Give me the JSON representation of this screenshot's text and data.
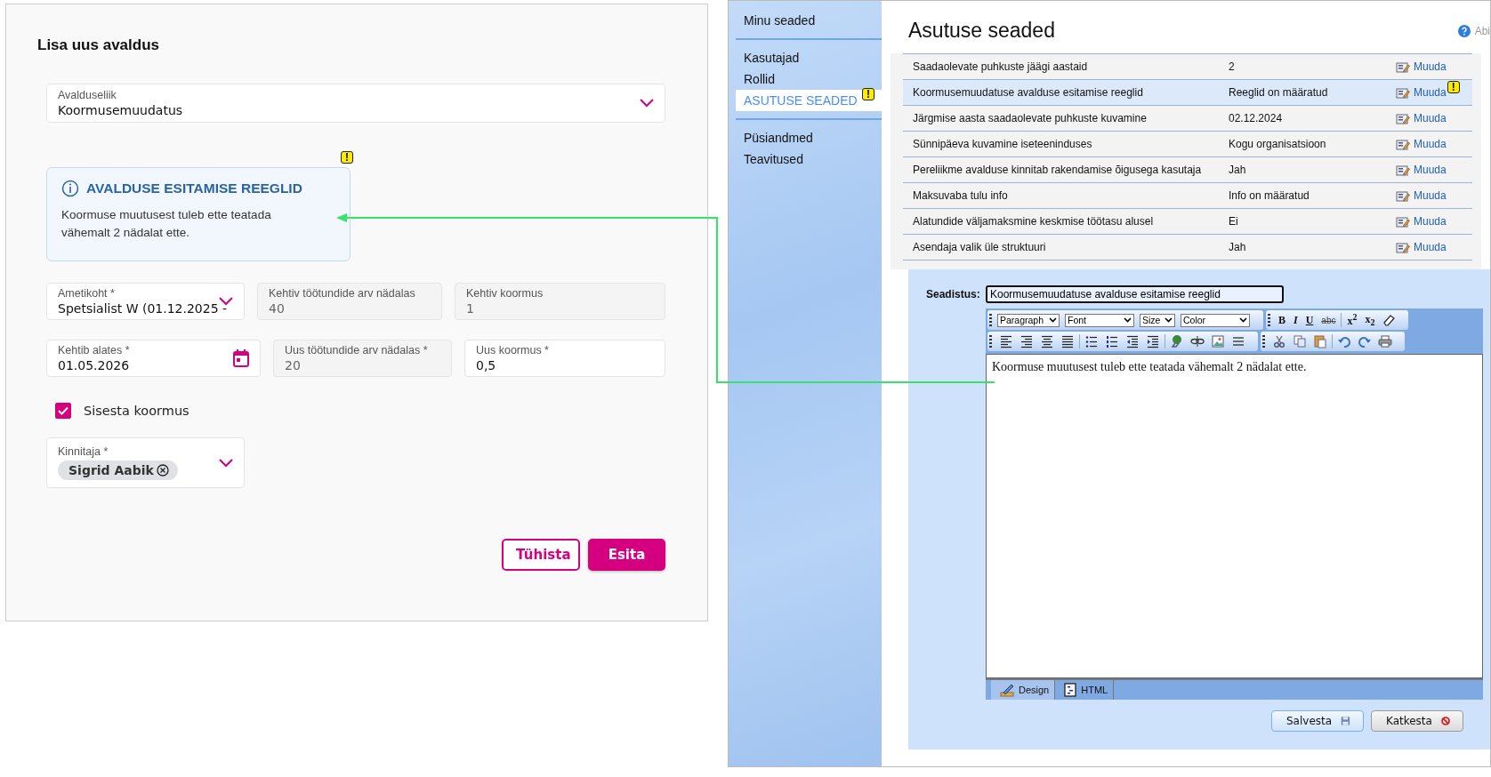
{
  "form": {
    "title": "Lisa uus avaldus",
    "type_field": {
      "label": "Avalduseliik",
      "value": "Koormusemuudatus"
    },
    "info": {
      "title": "AVALDUSE ESITAMISE REEGLID",
      "text": "Koormuse muutusest tuleb ette teatada vähemalt 2 nädalat ette.",
      "flag": "!"
    },
    "field_rows": [
      [
        {
          "kind": "select",
          "label": "Ametikoht *",
          "value": "Spetsialist W (01.12.2025 -",
          "disabled": false
        },
        {
          "kind": "text",
          "label": "Kehtiv töötundide arv nädalas",
          "value": "40",
          "disabled": true
        },
        {
          "kind": "text",
          "label": "Kehtiv koormus",
          "value": "1",
          "disabled": true
        }
      ],
      [
        {
          "kind": "date",
          "label": "Kehtib alates *",
          "value": "01.05.2026",
          "disabled": false
        },
        {
          "kind": "text",
          "label": "Uus töötundide arv nädalas *",
          "value": "20",
          "disabled": true
        },
        {
          "kind": "text",
          "label": "Uus koormus *",
          "value": "0,5",
          "disabled": false
        }
      ]
    ],
    "checkbox": {
      "label": "Sisesta koormus",
      "checked": true
    },
    "approver": {
      "label": "Kinnitaja *",
      "chip": "Sigrid Aabik"
    },
    "buttons": [
      {
        "label": "Tühista",
        "kind": "secondary"
      },
      {
        "label": "Esita",
        "kind": "primary"
      }
    ]
  },
  "settings": {
    "sidebar": [
      {
        "items": [
          {
            "label": "Minu seaded",
            "selected": false
          }
        ]
      },
      {
        "items": [
          {
            "label": "Kasutajad",
            "selected": false
          },
          {
            "label": "Rollid",
            "selected": false
          },
          {
            "label": "ASUTUSE SEADED",
            "selected": true,
            "flag": "!"
          }
        ]
      },
      {
        "items": [
          {
            "label": "Püsiandmed",
            "selected": false
          },
          {
            "label": "Teavitused",
            "selected": false
          }
        ]
      }
    ],
    "title": "Asutuse seaded",
    "help": "Abi",
    "rows": [
      {
        "name": "Saadaolevate puhkuste jäägi aastaid",
        "value": "2",
        "action": "Muuda",
        "selected": false
      },
      {
        "name": "Koormusemuudatuse avalduse esitamise reeglid",
        "value": "Reeglid on määratud",
        "action": "Muuda",
        "selected": true,
        "flag": "!"
      },
      {
        "name": "Järgmise aasta saadaolevate puhkuste kuvamine",
        "value": "02.12.2024",
        "action": "Muuda",
        "selected": false
      },
      {
        "name": "Sünnipäeva kuvamine iseteeninduses",
        "value": "Kogu organisatsioon",
        "action": "Muuda",
        "selected": false
      },
      {
        "name": "Pereliikme avalduse kinnitab rakendamise õigusega kasutaja",
        "value": "Jah",
        "action": "Muuda",
        "selected": false
      },
      {
        "name": "Maksuvaba tulu info",
        "value": "Info on määratud",
        "action": "Muuda",
        "selected": false
      },
      {
        "name": "Alatundide väljamaksmine keskmise töötasu alusel",
        "value": "Ei",
        "action": "Muuda",
        "selected": false
      },
      {
        "name": "Asendaja valik üle struktuuri",
        "value": "Jah",
        "action": "Muuda",
        "selected": false
      }
    ],
    "editor": {
      "label": "Seadistus:",
      "name_value": "Koormusemuudatuse avalduse esitamise reeglid",
      "dropdowns": [
        "Paragraph",
        "Font",
        "Size",
        "Color"
      ],
      "format_buttons": [
        "B",
        "I",
        "U",
        "abc",
        "x$^{2}$",
        "x$_{2}$"
      ],
      "content": "Koormuse muutusest tuleb ette teatada vähemalt 2 nädalat ette.",
      "tabs": [
        {
          "label": "Design",
          "selected": true
        },
        {
          "label": "HTML",
          "selected": false
        }
      ]
    },
    "buttons": [
      {
        "label": "Salvesta",
        "kind": "save"
      },
      {
        "label": "Katkesta",
        "kind": "cancel"
      }
    ]
  }
}
